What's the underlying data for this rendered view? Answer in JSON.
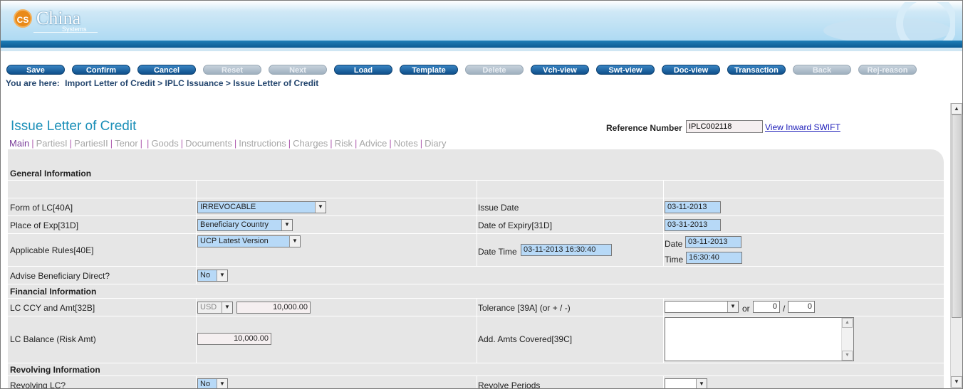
{
  "header": {
    "logo_mark": "CS",
    "logo_name": "China",
    "logo_sub": "Systems"
  },
  "toolbar": [
    {
      "label": "Save",
      "enabled": true
    },
    {
      "label": "Confirm",
      "enabled": true
    },
    {
      "label": "Cancel",
      "enabled": true
    },
    {
      "label": "Reset",
      "enabled": false
    },
    {
      "label": "Next",
      "enabled": false
    },
    {
      "label": "Load",
      "enabled": true
    },
    {
      "label": "Template",
      "enabled": true
    },
    {
      "label": "Delete",
      "enabled": false
    },
    {
      "label": "Vch-view",
      "enabled": true
    },
    {
      "label": "Swt-view",
      "enabled": true
    },
    {
      "label": "Doc-view",
      "enabled": true
    },
    {
      "label": "Transaction",
      "enabled": true
    },
    {
      "label": "Back",
      "enabled": false
    },
    {
      "label": "Rej-reason",
      "enabled": false
    }
  ],
  "breadcrumb": {
    "prefix": "You are here:",
    "path": "Import Letter of Credit > IPLC Issuance > Issue Letter of Credit"
  },
  "page": {
    "title": "Issue Letter of Credit",
    "ref_label": "Reference Number",
    "ref_value": "IPLC002118",
    "view_swift": "View Inward SWIFT"
  },
  "tabs": [
    "Main",
    "PartiesI",
    "PartiesII",
    "Tenor",
    "",
    "Goods",
    "Documents",
    "Instructions",
    "Charges",
    "Risk",
    "Advice",
    "Notes",
    "Diary"
  ],
  "sections": {
    "general": "General Information",
    "financial": "Financial Information",
    "revolving": "Revolving Information"
  },
  "fields": {
    "form_of_lc": {
      "label": "Form of LC[40A]",
      "value": "IRREVOCABLE"
    },
    "issue_date": {
      "label": "Issue Date",
      "value": "03-11-2013"
    },
    "place_of_exp": {
      "label": "Place of Exp[31D]",
      "value": "Beneficiary Country"
    },
    "date_of_expiry": {
      "label": "Date of Expiry[31D]",
      "value": "03-31-2013"
    },
    "applicable_rules": {
      "label": "Applicable Rules[40E]",
      "value": "UCP Latest Version"
    },
    "date_time": {
      "label": "Date Time",
      "value": "03-11-2013 16:30:40"
    },
    "date": {
      "label": "Date",
      "value": "03-11-2013"
    },
    "time": {
      "label": "Time",
      "value": "16:30:40"
    },
    "advise_direct": {
      "label": "Advise Beneficiary Direct?",
      "value": "No"
    },
    "lc_ccy_amt": {
      "label": "LC CCY and Amt[32B]",
      "ccy": "USD",
      "amount": "10,000.00"
    },
    "tolerance": {
      "label": "Tolerance [39A] (or + / -)",
      "value": "",
      "or": "or",
      "slash": "/",
      "plus": "0",
      "minus": "0"
    },
    "lc_balance": {
      "label": "LC Balance (Risk Amt)",
      "value": "10,000.00"
    },
    "add_amts": {
      "label": "Add. Amts Covered[39C]",
      "value": ""
    },
    "revolving_lc": {
      "label": "Revolving LC?",
      "value": "No"
    },
    "revolve_periods": {
      "label": "Revolve Periods",
      "value": ""
    }
  }
}
